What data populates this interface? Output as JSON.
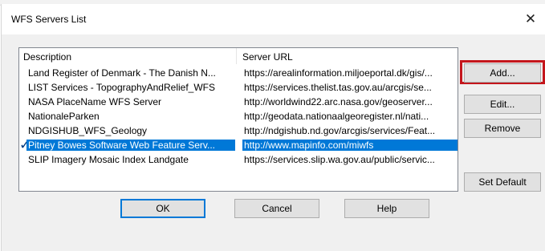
{
  "window": {
    "title": "WFS Servers List",
    "close_glyph": "✕"
  },
  "list": {
    "columns": [
      "Description",
      "Server URL"
    ],
    "rows": [
      {
        "description": "Land Register of Denmark - The Danish N...",
        "url": "https://arealinformation.miljoeportal.dk/gis/..."
      },
      {
        "description": "LIST Services - TopographyAndRelief_WFS",
        "url": "https://services.thelist.tas.gov.au/arcgis/se..."
      },
      {
        "description": "NASA PlaceName WFS Server",
        "url": "http://worldwind22.arc.nasa.gov/geoserver..."
      },
      {
        "description": "NationaleParken",
        "url": "http://geodata.nationaalgeoregister.nl/nati..."
      },
      {
        "description": "NDGISHUB_WFS_Geology",
        "url": "http://ndgishub.nd.gov/arcgis/services/Feat..."
      },
      {
        "description": "Pitney Bowes Software Web Feature Serv...",
        "url": "http://www.mapinfo.com/miwfs",
        "selected": true,
        "default": true
      },
      {
        "description": "SLIP Imagery Mosaic Index Landgate",
        "url": "https://services.slip.wa.gov.au/public/servic..."
      }
    ],
    "default_marker": "✓",
    "selection_color": "#0078d7"
  },
  "side_buttons": {
    "add": "Add...",
    "edit": "Edit...",
    "remove": "Remove",
    "set_default": "Set Default"
  },
  "bottom_buttons": {
    "ok": "OK",
    "cancel": "Cancel",
    "help": "Help"
  },
  "highlight_color": "#c4161c"
}
